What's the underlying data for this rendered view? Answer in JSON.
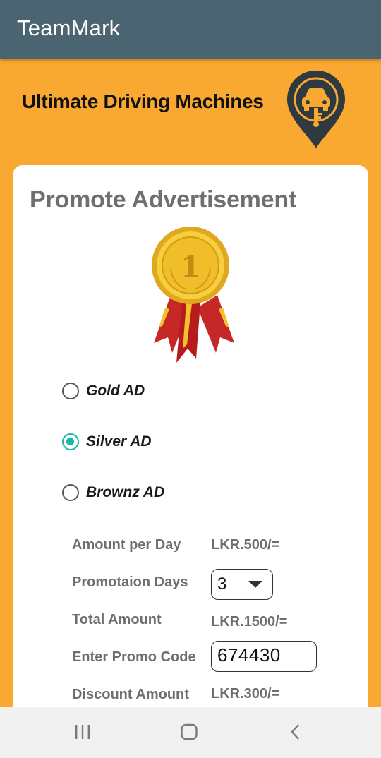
{
  "app": {
    "title": "TeamMark"
  },
  "brand": {
    "name": "Ultimate Driving Machines"
  },
  "card": {
    "title": "Promote Advertisement",
    "ad_options": [
      {
        "label": "Gold AD",
        "selected": false
      },
      {
        "label": "Silver AD",
        "selected": true
      },
      {
        "label": "Brownz AD",
        "selected": false
      }
    ],
    "fields": {
      "amount_label": "Amount per Day",
      "amount_value": "LKR.500/=",
      "days_label": "Promotaion Days",
      "days_value": "3",
      "total_label": "Total Amount",
      "total_value": "LKR.1500/=",
      "promo_label": "Enter Promo Code",
      "promo_value": "674430",
      "discount_label": "Discount Amount",
      "discount_value": "LKR.300/="
    }
  },
  "colors": {
    "appbar": "#4B6472",
    "background": "#F9A832",
    "radio_accent": "#18B7A8",
    "medal_gold": "#F2C12E",
    "ribbon_red": "#C62828"
  },
  "icons": [
    "car-key-location-logo",
    "gold-medal-icon",
    "recent-apps-icon",
    "home-icon",
    "back-icon"
  ]
}
